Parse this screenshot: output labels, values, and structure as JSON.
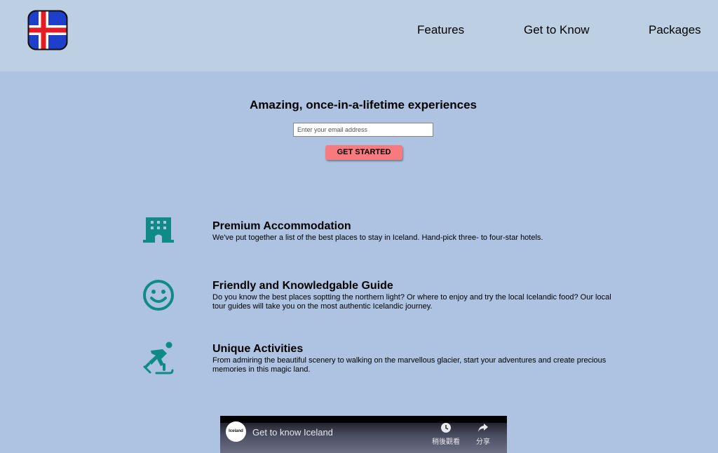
{
  "header": {
    "logo_icon": "iceland-flag-icon",
    "nav": [
      "Features",
      "Get to Know",
      "Packages"
    ]
  },
  "hero": {
    "title": "Amazing, once-in-a-lifetime experiences",
    "email_placeholder": "Enter your email address",
    "cta_label": "GET STARTED"
  },
  "features": [
    {
      "icon": "hotel-icon",
      "title": "Premium Accommodation",
      "description": "We've put together a list of the best places to stay in Iceland. Hand-pick three- to four-star hotels."
    },
    {
      "icon": "smiley-icon",
      "title": "Friendly and Knowledgable Guide",
      "description": "Do you know the best places soptting the northern light? Or where to enjoy and try the local Icelandic food? Our local tour guides will take you on the most authentic Icelandic journey."
    },
    {
      "icon": "ice-skating-icon",
      "title": "Unique Activities",
      "description": "From admiring the beautiful scenery to walking on the marvellous glacier, start your adventures and create precious memories in this magic land."
    }
  ],
  "video": {
    "channel_label": "Iceland",
    "title": "Get to know Iceland",
    "watch_later": "稍後觀看",
    "share": "分享"
  },
  "colors": {
    "page_bg": "#adc3e1",
    "header_bg": "#bccfe3",
    "cta_bg": "#f77b7e",
    "icon_teal": "#0f8a86"
  }
}
